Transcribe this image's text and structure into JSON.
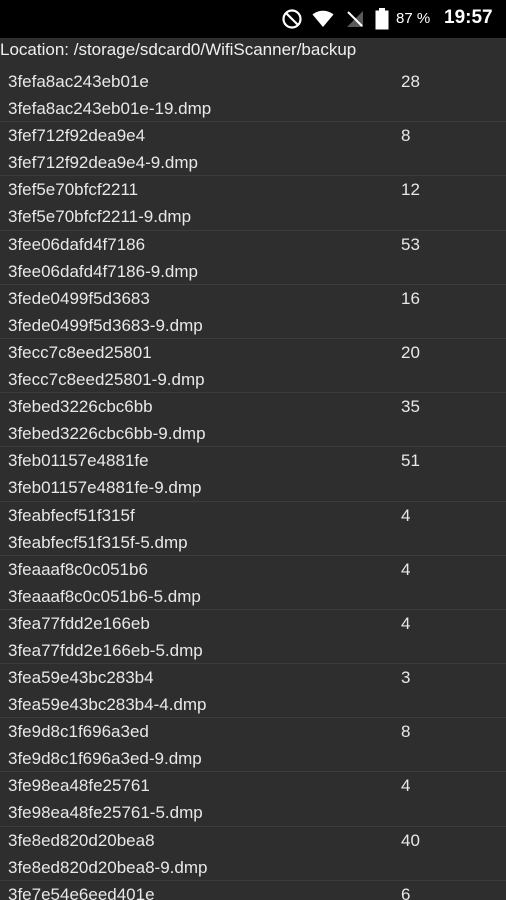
{
  "status_bar": {
    "battery_percent": "87 %",
    "time": "19:57",
    "icons": [
      "do-not-disturb-icon",
      "wifi-icon",
      "no-signal-icon",
      "battery-icon"
    ]
  },
  "location": "Location: /storage/sdcard0/WifiScanner/backup",
  "items": [
    {
      "name": "3fefa8ac243eb01e",
      "file": "3fefa8ac243eb01e-19.dmp",
      "count": "28"
    },
    {
      "name": "3fef712f92dea9e4",
      "file": "3fef712f92dea9e4-9.dmp",
      "count": "8"
    },
    {
      "name": "3fef5e70bfcf2211",
      "file": "3fef5e70bfcf2211-9.dmp",
      "count": "12"
    },
    {
      "name": "3fee06dafd4f7186",
      "file": "3fee06dafd4f7186-9.dmp",
      "count": "53"
    },
    {
      "name": "3fede0499f5d3683",
      "file": "3fede0499f5d3683-9.dmp",
      "count": "16"
    },
    {
      "name": "3fecc7c8eed25801",
      "file": "3fecc7c8eed25801-9.dmp",
      "count": "20"
    },
    {
      "name": "3febed3226cbc6bb",
      "file": "3febed3226cbc6bb-9.dmp",
      "count": "35"
    },
    {
      "name": "3feb01157e4881fe",
      "file": "3feb01157e4881fe-9.dmp",
      "count": "51"
    },
    {
      "name": "3feabfecf51f315f",
      "file": "3feabfecf51f315f-5.dmp",
      "count": "4"
    },
    {
      "name": "3feaaaf8c0c051b6",
      "file": "3feaaaf8c0c051b6-5.dmp",
      "count": "4"
    },
    {
      "name": "3fea77fdd2e166eb",
      "file": "3fea77fdd2e166eb-5.dmp",
      "count": "4"
    },
    {
      "name": "3fea59e43bc283b4",
      "file": "3fea59e43bc283b4-4.dmp",
      "count": "3"
    },
    {
      "name": "3fe9d8c1f696a3ed",
      "file": "3fe9d8c1f696a3ed-9.dmp",
      "count": "8"
    },
    {
      "name": "3fe98ea48fe25761",
      "file": "3fe98ea48fe25761-5.dmp",
      "count": "4"
    },
    {
      "name": "3fe8ed820d20bea8",
      "file": "3fe8ed820d20bea8-9.dmp",
      "count": "40"
    },
    {
      "name": "3fe7e54e6eed401e",
      "file": "",
      "count": "6"
    }
  ]
}
